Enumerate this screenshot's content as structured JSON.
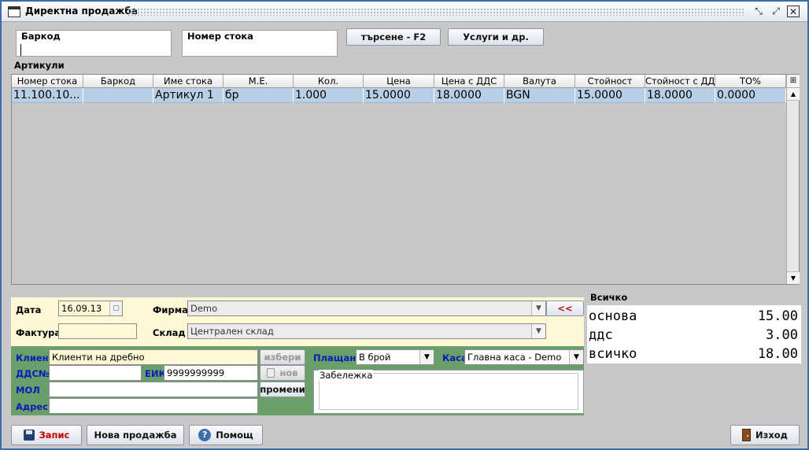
{
  "window": {
    "title": "Директна продажба"
  },
  "barcode_field": {
    "label": "Баркод",
    "value": ""
  },
  "item_number_field": {
    "label": "Номер стока",
    "value": ""
  },
  "buttons": {
    "search": "търсене - F2",
    "services": "Услуги и др.",
    "choose": "избери",
    "new": "нов",
    "change": "промени",
    "transfer": "<<",
    "save": "Запис",
    "new_sale": "Нова продажба",
    "help": "Помощ",
    "exit": "Изход"
  },
  "articles": {
    "label": "Артикули",
    "columns": [
      "Номер стока",
      "Баркод",
      "Име стока",
      "М.Е.",
      "Кол.",
      "Цена",
      "Цена с ДДС",
      "Валута",
      "Стойност",
      "Стойност с ДДС",
      "ТО%"
    ],
    "rows": [
      [
        "11.100.10...",
        "",
        "Артикул 1",
        "бр",
        "1.000",
        "15.0000",
        "18.0000",
        "BGN",
        "15.0000",
        "18.0000",
        "0.0000"
      ]
    ]
  },
  "form": {
    "date_label": "Дата",
    "date_value": "16.09.13",
    "company_label": "Фирма",
    "company_value": "Demo",
    "invoice_label": "Фактура",
    "invoice_value": "",
    "warehouse_label": "Склад",
    "warehouse_value": "Централен склад",
    "client_label": "Клиент",
    "client_value": "Клиенти на дребно",
    "vat_label": "ДДС№",
    "vat_value": "",
    "eik_label": "ЕИК",
    "eik_value": "9999999999",
    "mol_label": "МОЛ",
    "mol_value": "",
    "address_label": "Адрес",
    "address_value": "",
    "payment_label": "Плащане",
    "payment_value": "В брой",
    "cashbox_label": "Каса",
    "cashbox_value": "Главна каса - Demo",
    "note_label": "Забележка",
    "note_value": ""
  },
  "totals": {
    "label": "Всичко",
    "base_label": "основа",
    "base_value": "15.00",
    "vat_label": "ддс",
    "vat_value": "3.00",
    "total_label": "всичко",
    "total_value": "18.00"
  },
  "icons": {
    "app": "window-icon",
    "save": "floppy-disk-icon",
    "help": "question-icon",
    "exit": "door-icon"
  },
  "colors": {
    "window_border": "#3f6ca8",
    "row_selected": "#b8cfe5",
    "yellow_panel": "#fdf8d6",
    "green_panel": "#6a9e6a",
    "label_blue": "#0a1ab8",
    "save_red": "#c00000"
  }
}
